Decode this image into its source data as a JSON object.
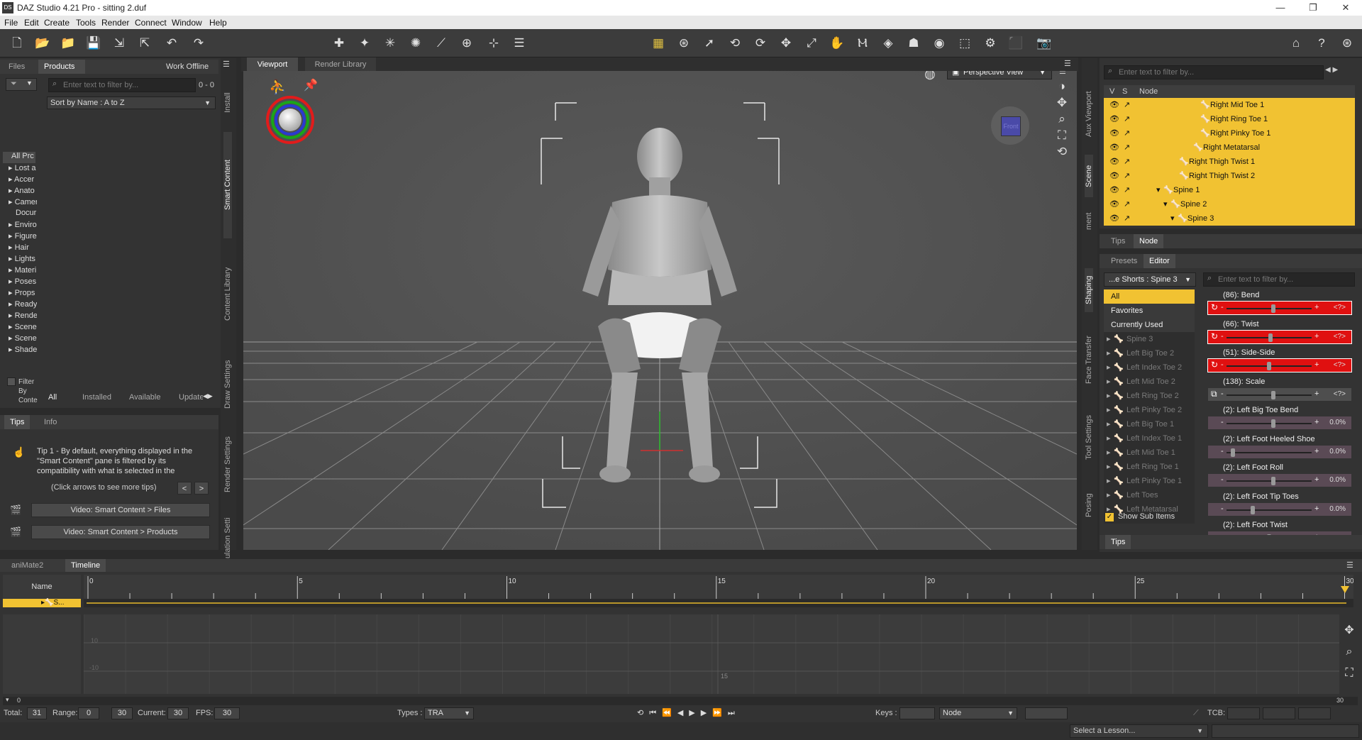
{
  "window": {
    "title": "DAZ Studio 4.21 Pro - sitting 2.duf",
    "icon_label": "DS",
    "minimize": "—",
    "maximize": "❐",
    "close": "✕"
  },
  "menu": [
    "File",
    "Edit",
    "Create",
    "Tools",
    "Render",
    "Connect",
    "Window",
    "Help"
  ],
  "left_panel": {
    "tabs": [
      "Files",
      "Products",
      "Work Offline"
    ],
    "search_placeholder": "Enter text to filter by...",
    "count": "0 - 0",
    "sort": "Sort by Name : A to Z",
    "categories": [
      "All Prc",
      "Lost a",
      "Accer",
      "Anato",
      "Camer",
      "Docur",
      "Enviro",
      "Figure",
      "Hair",
      "Lights",
      "Materi",
      "Poses",
      "Props",
      "Ready",
      "Rende",
      "Scene",
      "Scene",
      "Shade"
    ],
    "filter_label": "Filter By Conte",
    "bottom_tabs": [
      "All",
      "Installed",
      "Available",
      "Updates"
    ],
    "vertical_tabs": [
      "Install",
      "Smart Content",
      "Content Library",
      "Draw Settings",
      "Render Settings",
      "Simulation Setti"
    ]
  },
  "tips_panel": {
    "tabs": [
      "Tips",
      "Info"
    ],
    "tip_bold": "Tip 1",
    "tip_text": " - By default, everything displayed in the \"Smart Content\" pane is filtered by its compatibility with what is selected in the",
    "arrows_hint": "(Click arrows to see more tips)",
    "video1": "Video: Smart Content > Files",
    "video2": "Video: Smart Content > Products"
  },
  "viewport": {
    "tabs": [
      "Viewport",
      "Render Library"
    ],
    "view_mode": "Perspective View",
    "cube_label": "Front"
  },
  "scene_panel": {
    "search_placeholder": "Enter text to filter by...",
    "header": {
      "v": "V",
      "s": "S",
      "node": "Node"
    },
    "rows": [
      "Right Mid Toe 1",
      "Right Ring Toe 1",
      "Right Pinky Toe 1",
      "Right Metatarsal",
      "Right Thigh Twist 1",
      "Right Thigh Twist 2",
      "Spine 1",
      "Spine 2",
      "Spine 3"
    ],
    "lower_tabs": [
      "Tips",
      "Node"
    ],
    "vertical_tabs": [
      "Aux Viewport",
      "Scene",
      "ment"
    ]
  },
  "parameters": {
    "tabs": [
      "Presets",
      "Editor"
    ],
    "node_select": "...e Shorts : Spine 3",
    "search_placeholder": "Enter text to filter by...",
    "filters": [
      "All",
      "Favorites",
      "Currently Used"
    ],
    "list": [
      "Spine 3",
      "Left Big Toe 2",
      "Left Index Toe 2",
      "Left Mid Toe 2",
      "Left Ring Toe 2",
      "Left Pinky Toe 2",
      "Left Big Toe 1",
      "Left Index Toe 1",
      "Left Mid Toe 1",
      "Left Ring Toe 1",
      "Left Pinky Toe 1",
      "Left Toes",
      "Left Metatarsal"
    ],
    "show_sub_items": "Show Sub Items",
    "sliders": [
      {
        "name": "(86): Bend",
        "value": "<?>",
        "level": 0.55,
        "style": "red"
      },
      {
        "name": "(66): Twist",
        "value": "<?>",
        "level": 0.52,
        "style": "red"
      },
      {
        "name": "(51): Side-Side",
        "value": "<?>",
        "level": 0.5,
        "style": "red"
      },
      {
        "name": "(138): Scale",
        "value": "<?>",
        "level": 0.55,
        "style": "gray"
      },
      {
        "name": "(2): Left Big Toe Bend",
        "value": "0.0%",
        "level": 0.55,
        "style": "mauve"
      },
      {
        "name": "(2): Left Foot Heeled Shoe",
        "value": "0.0%",
        "level": 0.05,
        "style": "mauve"
      },
      {
        "name": "(2): Left Foot Roll",
        "value": "0.0%",
        "level": 0.55,
        "style": "mauve"
      },
      {
        "name": "(2): Left Foot Tip Toes",
        "value": "0.0%",
        "level": 0.3,
        "style": "mauve"
      },
      {
        "name": "(2): Left Foot Twist",
        "value": "",
        "level": 0.5,
        "style": "mauve"
      }
    ],
    "bottom_tab": "Tips",
    "vertical_tabs": [
      "Shaping",
      "Face Transfer",
      "Tool Settings",
      "Posing"
    ]
  },
  "timeline": {
    "tabs": [
      "aniMate2",
      "Timeline"
    ],
    "name_header": "Name",
    "track_label": "S...",
    "ruler": [
      "0",
      "5",
      "10",
      "15",
      "20",
      "25",
      "30"
    ],
    "graph_labels": [
      "10",
      "-10",
      "15"
    ],
    "range_start": "0",
    "range_end": "30",
    "total_label": "Total:",
    "total": "31",
    "range_label": "Range:",
    "range_from": "0",
    "range_to": "30",
    "current_label": "Current:",
    "current": "30",
    "fps_label": "FPS:",
    "fps": "30",
    "types_label": "Types :",
    "types": "TRA",
    "keys_label": "Keys :",
    "keys_node": "Node",
    "tcb_label": "TCB:"
  },
  "status": {
    "lesson": "Select a Lesson..."
  },
  "colors": {
    "accent": "#f1c232",
    "red_slider": "#e01010"
  }
}
